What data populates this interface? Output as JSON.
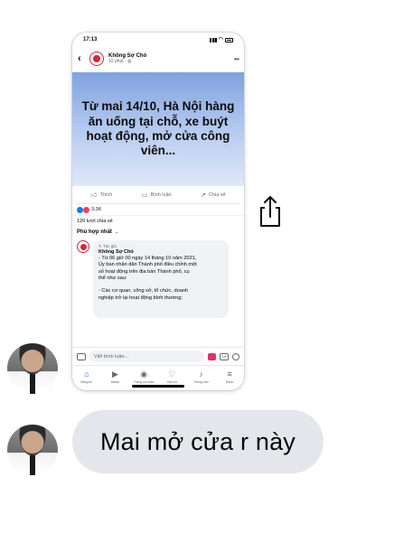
{
  "screenshot": {
    "status_time": "17:13",
    "page_name": "Không Sợ Chó",
    "post_time": "10 phút · ",
    "image_text": "Từ mai 14/10, Hà Nội hàng ăn uống tại chỗ, xe buýt hoạt động, mở cửa công viên...",
    "actions": {
      "like": "Thích",
      "comment": "Bình luận",
      "share": "Chia sẻ"
    },
    "reaction_count": "3,3K",
    "share_count": "120 lượt chia sẻ",
    "sort_label": "Phù hợp nhất",
    "comment": {
      "author_tag": "Tác giả",
      "author": "Không Sợ Chó",
      "lines": [
        "- Từ 06 giờ 00 ngày 14 tháng 10 năm 2021,",
        "Ủy ban nhân dân Thành phố điều chỉnh một",
        "số hoạt động trên địa bàn Thành phố, cụ",
        "thể như sau:",
        "",
        "- Các cơ quan, công sở, tổ chức, doanh",
        "nghiệp trở lại hoạt động bình thường;"
      ]
    },
    "composer_placeholder": "Viết bình luận...",
    "gif_label": "GIF",
    "tabs": [
      {
        "label": "Bảng tin",
        "icon": "home-icon"
      },
      {
        "label": "Watch",
        "icon": "watch-icon"
      },
      {
        "label": "Trang cá nhân",
        "icon": "profile-icon"
      },
      {
        "label": "Hẹn hò",
        "icon": "dating-icon"
      },
      {
        "label": "Thông báo",
        "icon": "bell-icon"
      },
      {
        "label": "Menu",
        "icon": "menu-icon"
      }
    ]
  },
  "message": {
    "text": "Mai mở cửa r này"
  },
  "colors": {
    "bubble_bg": "#e4e6eb",
    "fb_blue": "#1877f2"
  }
}
